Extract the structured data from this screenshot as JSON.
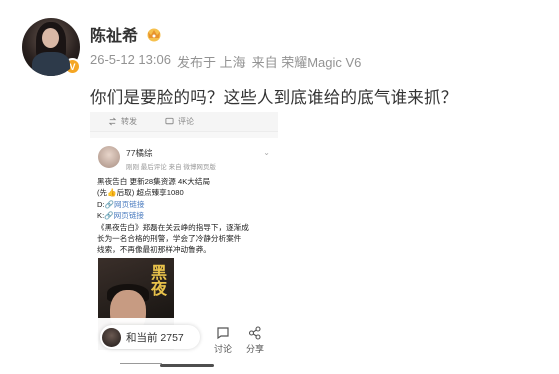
{
  "author": {
    "name": "陈祉希",
    "badge_icon": "crown-icon",
    "verified_icon": "verified-v-icon",
    "verified_label": "V"
  },
  "meta": {
    "date": "26-5-12 13:06",
    "location": "发布于 上海",
    "source": "来自 荣耀Magic V6"
  },
  "post_text": "你们是要脸的吗？这些人到底谁给的底气谁来抓？",
  "screenshot": {
    "topbar": {
      "repost": "转发",
      "comment": "评论"
    },
    "user": {
      "name": "77橘综",
      "sub": "刚刚 最后评论 来自 微博网页版"
    },
    "lines": {
      "l1": "黑夜告白  更新28集资源  4K大结局",
      "l2": "(先👍后取) 超点臻享1080",
      "l3_prefix": "D:",
      "l3_link": "🔗网页链接",
      "l4_prefix": "K:",
      "l4_link": "🔗网页链接",
      "l5": "《黑夜告白》郑磊在关云峥的指导下，逐渐成",
      "l6": "长为一名合格的刑警，学会了冷静分析案件",
      "l7": "线索，不再像最初那样冲动鲁莽。"
    },
    "poster": {
      "tag": "",
      "title": "黑夜"
    },
    "bottom": {
      "count_text": "和当前 2757",
      "comment_label": "讨论",
      "share_label": "分享"
    }
  },
  "colors": {
    "meta_gray": "#939393",
    "link_blue": "#4a7bbf",
    "badge_orange": "#f5a623"
  }
}
